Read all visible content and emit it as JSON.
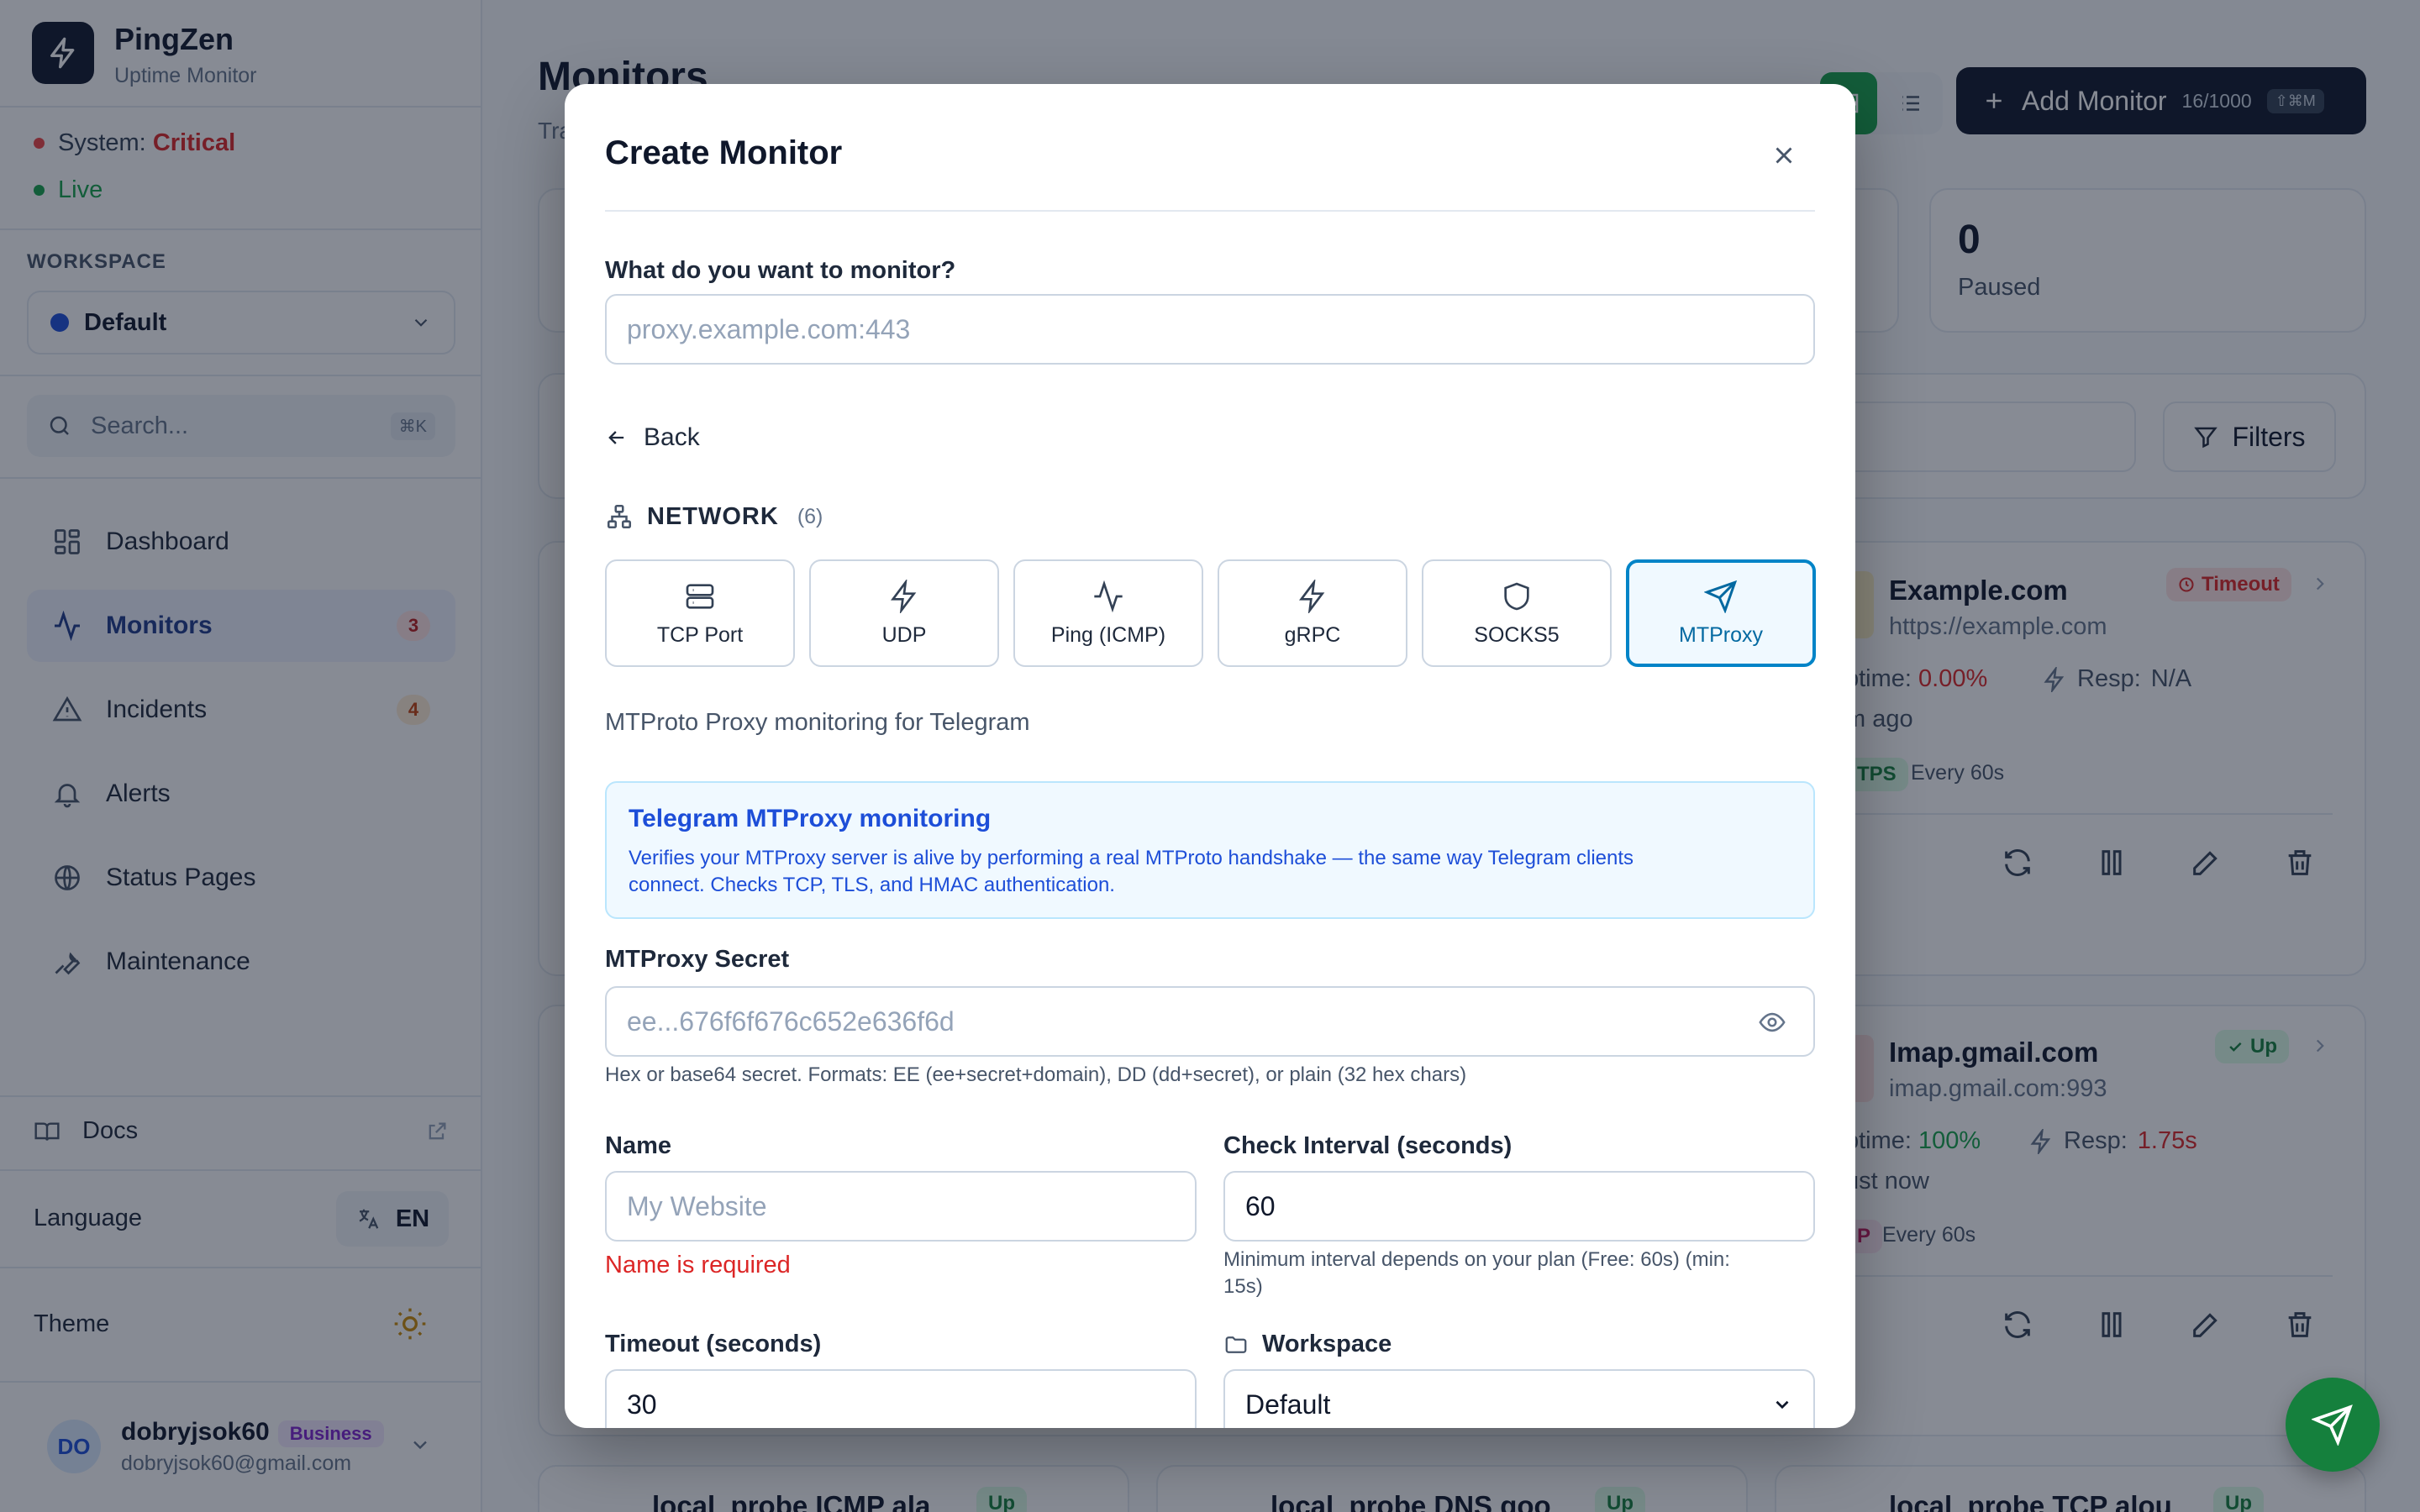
{
  "brand": {
    "name": "PingZen",
    "subtitle": "Uptime Monitor"
  },
  "system": {
    "label": "System:",
    "state": "Critical",
    "live": "Live"
  },
  "workspace": {
    "section_label": "WORKSPACE",
    "selected": "Default"
  },
  "search": {
    "placeholder": "Search...",
    "shortcut": "⌘K"
  },
  "nav": [
    {
      "label": "Dashboard",
      "badge": ""
    },
    {
      "label": "Monitors",
      "badge": "3"
    },
    {
      "label": "Incidents",
      "badge": "4"
    },
    {
      "label": "Alerts",
      "badge": ""
    },
    {
      "label": "Status Pages",
      "badge": ""
    },
    {
      "label": "Maintenance",
      "badge": ""
    }
  ],
  "sidebar_footer": {
    "docs": "Docs",
    "language_label": "Language",
    "language_value": "EN",
    "theme_label": "Theme"
  },
  "user": {
    "initials": "DO",
    "name": "dobryjsok60",
    "plan": "Business",
    "email": "dobryjsok60@gmail.com"
  },
  "page": {
    "title": "Monitors",
    "subtitle": "Tra"
  },
  "toolbar": {
    "add_label": "Add Monitor",
    "quota": "16/1000",
    "shortcut": "⇧⌘M",
    "filters_label": "Filters"
  },
  "stats": {
    "paused_value": "0",
    "paused_label": "Paused"
  },
  "monitor_cards": [
    {
      "title": "Example.com",
      "url": "https://example.com",
      "status": "Timeout",
      "uptime_label": "ptime:",
      "uptime": "0.00%",
      "resp_label": "Resp:",
      "resp": "N/A",
      "ago": "m ago",
      "proto": "TPS",
      "interval": "Every 60s"
    },
    {
      "title": "Imap.gmail.com",
      "url": "imap.gmail.com:993",
      "status": "Up",
      "uptime_label": "ptime:",
      "uptime": "100%",
      "resp_label": "Resp:",
      "resp": "1.75s",
      "ago": "ust now",
      "proto": "P",
      "interval": "Every 60s"
    }
  ],
  "bottom_cards": [
    {
      "title": "local_probe ICMP ala",
      "status": "Up"
    },
    {
      "title": "local_probe DNS goo",
      "status": "Up"
    },
    {
      "title": "local_probe TCP alou",
      "status": "Up"
    }
  ],
  "modal": {
    "title": "Create Monitor",
    "target_label": "What do you want to monitor?",
    "target_placeholder": "proxy.example.com:443",
    "back_label": "Back",
    "section_title": "NETWORK",
    "section_count": "(6)",
    "types": [
      {
        "label": "TCP Port",
        "icon": "server-icon"
      },
      {
        "label": "UDP",
        "icon": "bolt-icon"
      },
      {
        "label": "Ping (ICMP)",
        "icon": "activity-icon"
      },
      {
        "label": "gRPC",
        "icon": "bolt-icon"
      },
      {
        "label": "SOCKS5",
        "icon": "shield-icon"
      },
      {
        "label": "MTProxy",
        "icon": "send-icon",
        "selected": true
      }
    ],
    "type_description": "MTProto Proxy monitoring for Telegram",
    "info_title": "Telegram MTProxy monitoring",
    "info_text_1": "Verifies your MTProxy server is alive by performing a real MTProto handshake — the same way Telegram clients",
    "info_text_2": "connect. Checks TCP, TLS, and HMAC authentication.",
    "secret_label": "MTProxy Secret",
    "secret_placeholder": "ee...676f6f676c652e636f6d",
    "secret_hint": "Hex or base64 secret. Formats: EE (ee+secret+domain), DD (dd+secret), or plain (32 hex chars)",
    "name_label": "Name",
    "name_placeholder": "My Website",
    "name_error": "Name is required",
    "interval_label": "Check Interval (seconds)",
    "interval_value": "60",
    "interval_hint_1": "Minimum interval depends on your plan (Free: 60s) (min:",
    "interval_hint_2": "15s)",
    "timeout_label": "Timeout (seconds)",
    "timeout_value": "30",
    "workspace_label": "Workspace",
    "workspace_value": "Default"
  },
  "colors": {
    "critical": "#dc2626",
    "live": "#16a34a",
    "accent": "#0284c7",
    "primary_button": "#0f172a"
  }
}
